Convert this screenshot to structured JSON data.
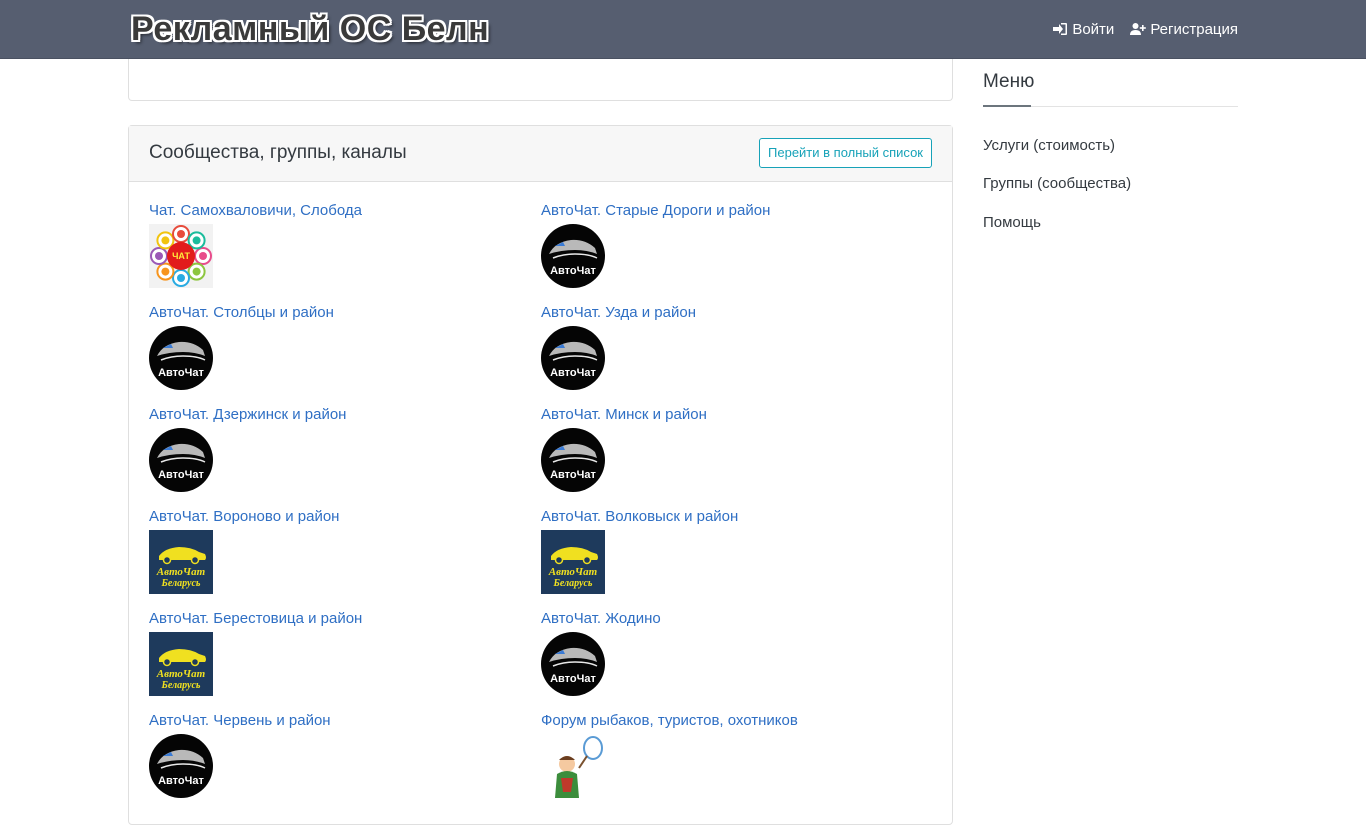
{
  "header": {
    "logo_text": "Рекламный ОС Белн",
    "login_label": "Войти",
    "register_label": "Регистрация",
    "login_icon": "sign-in-icon",
    "register_icon": "user-plus-icon"
  },
  "main": {
    "section_title": "Сообщества, группы, каналы",
    "full_list_button": "Перейти в полный список",
    "items": [
      {
        "label": "Чат. Самохваловичи, Слобода",
        "thumb": "chat-logo"
      },
      {
        "label": "АвтоЧат. Старые Дороги и район",
        "thumb": "autochat-black"
      },
      {
        "label": "АвтоЧат. Столбцы и район",
        "thumb": "autochat-black"
      },
      {
        "label": "АвтоЧат. Узда и район",
        "thumb": "autochat-black"
      },
      {
        "label": "АвтоЧат. Дзержинск и район",
        "thumb": "autochat-black"
      },
      {
        "label": "АвтоЧат. Минск и район",
        "thumb": "autochat-black"
      },
      {
        "label": "АвтоЧат. Вороново и район",
        "thumb": "autochat-belarus"
      },
      {
        "label": "АвтоЧат. Волковыск и район",
        "thumb": "autochat-belarus"
      },
      {
        "label": "АвтоЧат. Берестовица и район",
        "thumb": "autochat-belarus"
      },
      {
        "label": "АвтоЧат. Жодино",
        "thumb": "autochat-black"
      },
      {
        "label": "АвтоЧат. Червень и район",
        "thumb": "autochat-black"
      },
      {
        "label": "Форум рыбаков, туристов, охотников",
        "thumb": "fisher"
      }
    ],
    "thumb_texts": {
      "chat": "ЧАТ",
      "autochat": "АвтоЧат",
      "autochat_belarus_1": "АвтоЧат",
      "autochat_belarus_2": "Беларусь"
    }
  },
  "sidebar": {
    "title": "Меню",
    "items": [
      "Услуги (стоимость)",
      "Группы (сообщества)",
      "Помощь"
    ]
  },
  "colors": {
    "navbar": "#565e70",
    "link": "#2f6fc4",
    "accent_button": "#17a2b8"
  }
}
